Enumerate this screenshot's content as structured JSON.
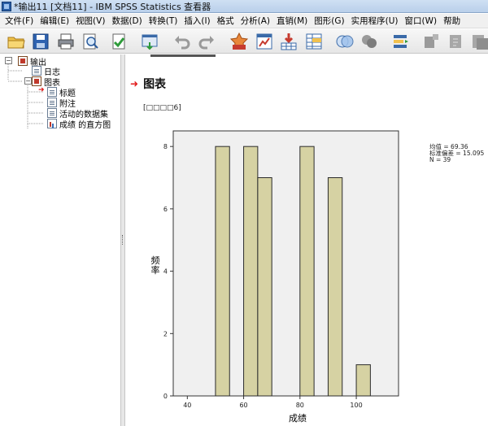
{
  "window": {
    "title": "*输出11 [文档11] - IBM SPSS Statistics 查看器"
  },
  "menu": [
    "文件(F)",
    "编辑(E)",
    "视图(V)",
    "数据(D)",
    "转换(T)",
    "插入(I)",
    "格式",
    "分析(A)",
    "直销(M)",
    "图形(G)",
    "实用程序(U)",
    "窗口(W)",
    "帮助"
  ],
  "toolbar": {
    "icons": [
      "open-folder-icon",
      "save-icon",
      "print-icon",
      "print-preview-icon",
      "export-icon",
      "recall-dialog-icon",
      "undo-icon",
      "redo-icon",
      "goto-data-icon",
      "goto-case-icon",
      "goto-variable-icon",
      "variables-icon",
      "show-all-icon",
      "hide-icon",
      "designate-window-icon",
      "promote-icon",
      "demote-icon",
      "collapse-icon"
    ]
  },
  "navigator": {
    "root": "输出",
    "log": "日志",
    "charts_group": "图表",
    "items": [
      "标题",
      "附注",
      "活动的数据集",
      "成绩 的直方图"
    ]
  },
  "content": {
    "section_title": "图表",
    "dataset_label": "[□□□□6]"
  },
  "chart_data": {
    "type": "bar",
    "title": "",
    "xlabel": "成绩",
    "ylabel": "频\n率",
    "x_ticks": [
      40,
      60,
      80,
      100
    ],
    "y_ticks": [
      0,
      2,
      4,
      6,
      8
    ],
    "xlim": [
      35,
      115
    ],
    "ylim": [
      0,
      8.5
    ],
    "bins": [
      {
        "x0": 45,
        "x1": 50,
        "count": 0
      },
      {
        "x0": 50,
        "x1": 55,
        "count": 8
      },
      {
        "x0": 55,
        "x1": 60,
        "count": 0
      },
      {
        "x0": 60,
        "x1": 65,
        "count": 8
      },
      {
        "x0": 65,
        "x1": 70,
        "count": 7
      },
      {
        "x0": 70,
        "x1": 75,
        "count": 0
      },
      {
        "x0": 75,
        "x1": 80,
        "count": 0
      },
      {
        "x0": 80,
        "x1": 85,
        "count": 8
      },
      {
        "x0": 85,
        "x1": 90,
        "count": 0
      },
      {
        "x0": 90,
        "x1": 95,
        "count": 7
      },
      {
        "x0": 95,
        "x1": 100,
        "count": 0
      },
      {
        "x0": 100,
        "x1": 105,
        "count": 1
      }
    ],
    "stats_lines": [
      "均值 = 69.36",
      "标准偏差 = 15.095",
      "N = 39"
    ],
    "colors": {
      "bar_fill": "#d6d2a3",
      "bar_stroke": "#2b2b2b",
      "plot_bg": "#f0f0f0"
    }
  }
}
